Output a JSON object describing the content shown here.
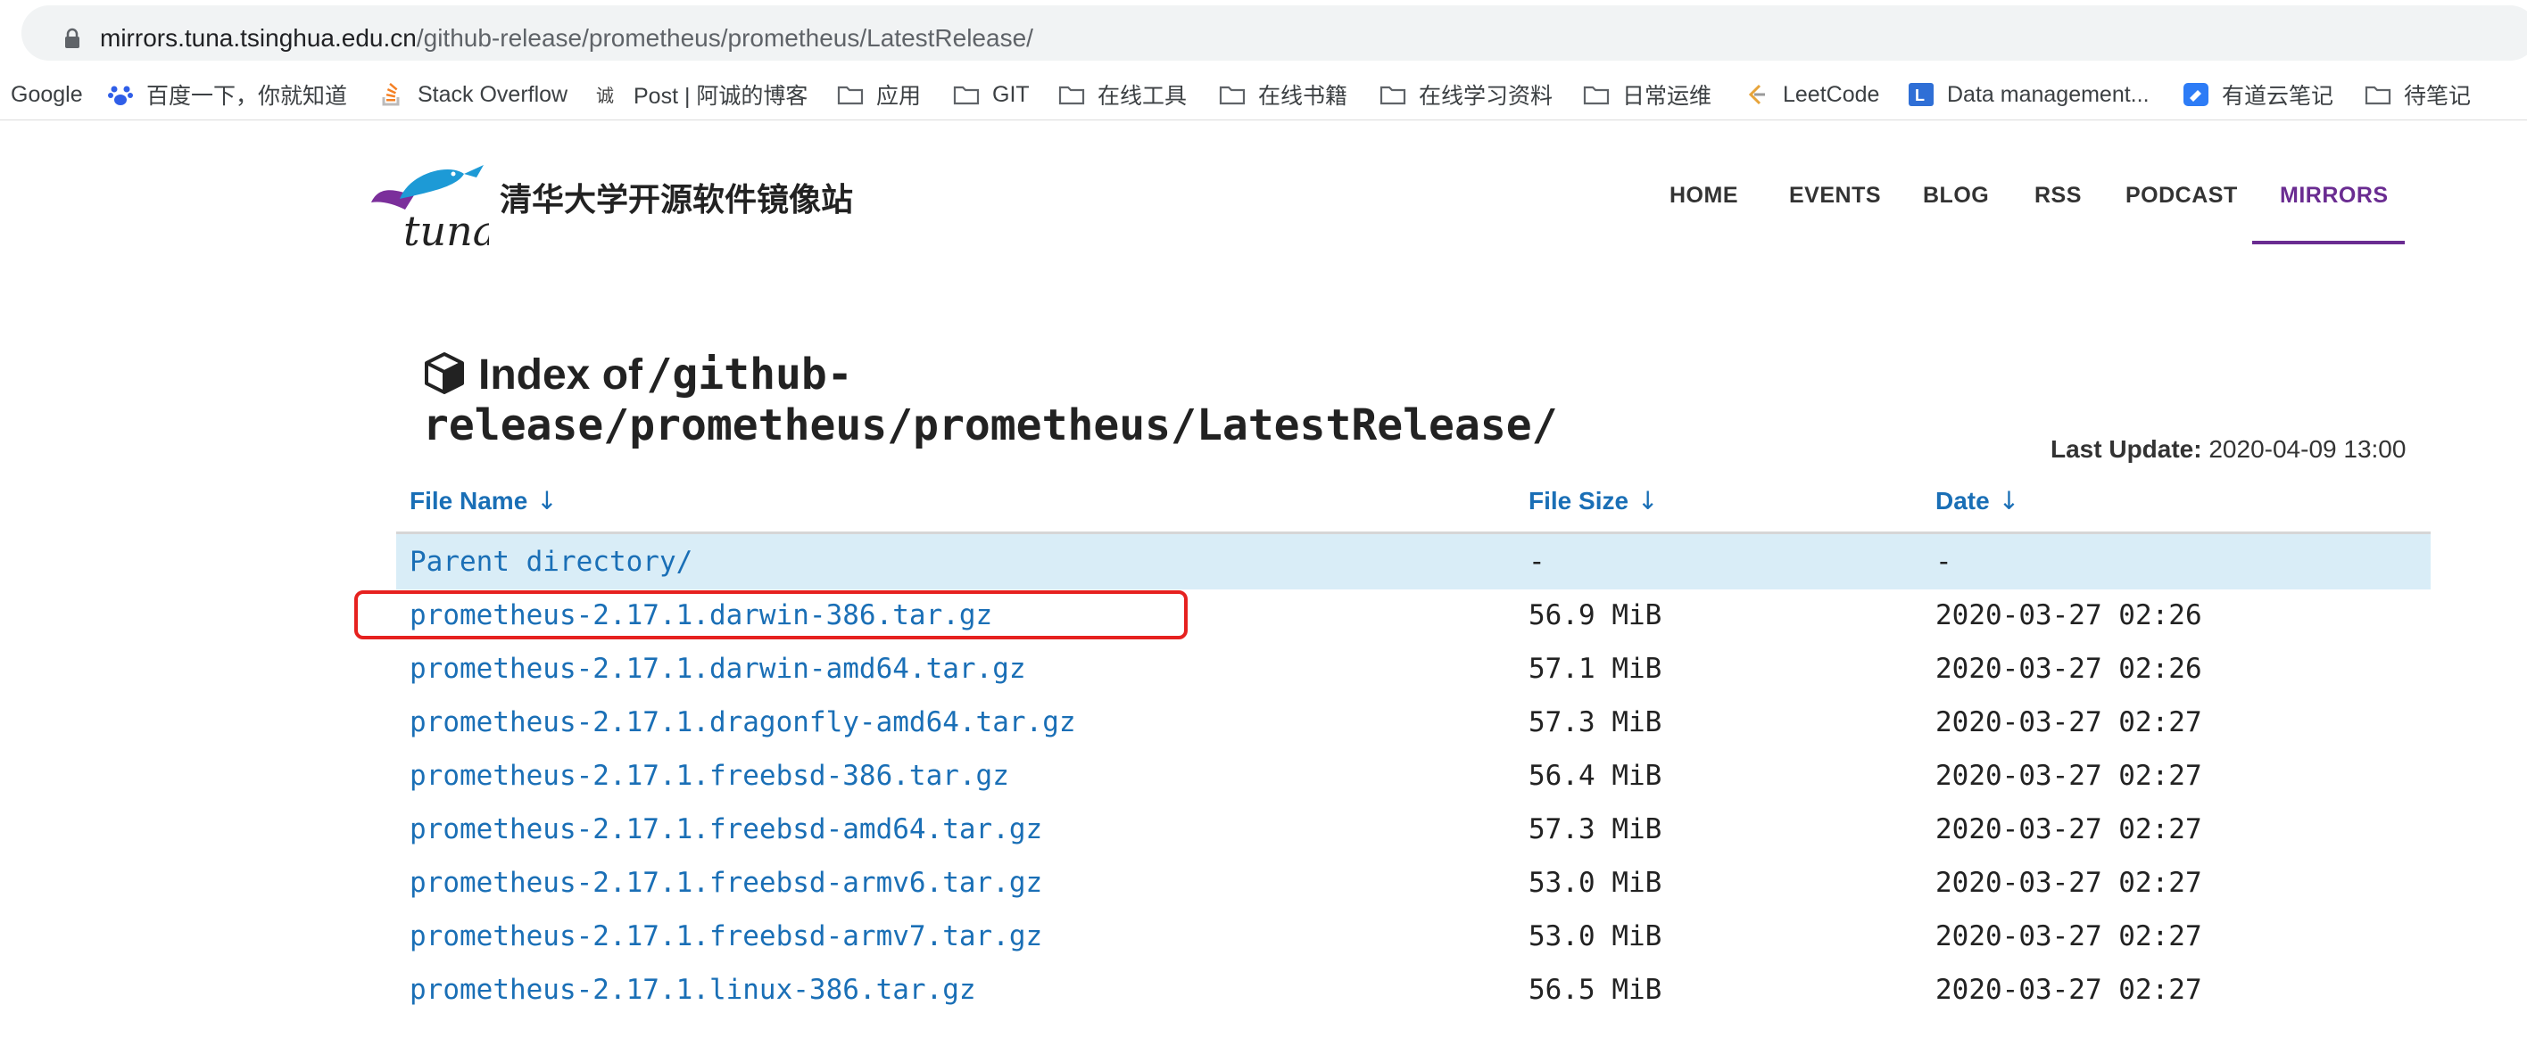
{
  "browser": {
    "url_host": "mirrors.tuna.tsinghua.edu.cn",
    "url_path": "/github-release/prometheus/prometheus/LatestRelease/"
  },
  "bookmarks": [
    {
      "label": "Google",
      "icon": "none"
    },
    {
      "label": "百度一下，你就知道",
      "icon": "baidu-paw-icon"
    },
    {
      "label": "Stack Overflow",
      "icon": "stackoverflow-icon"
    },
    {
      "label": "Post | 阿诚的博客",
      "icon": "blog-icon"
    },
    {
      "label": "应用",
      "icon": "folder-icon"
    },
    {
      "label": "GIT",
      "icon": "folder-icon"
    },
    {
      "label": "在线工具",
      "icon": "folder-icon"
    },
    {
      "label": "在线书籍",
      "icon": "folder-icon"
    },
    {
      "label": "在线学习资料",
      "icon": "folder-icon"
    },
    {
      "label": "日常运维",
      "icon": "folder-icon"
    },
    {
      "label": "LeetCode",
      "icon": "leetcode-icon"
    },
    {
      "label": "Data management...",
      "icon": "data-icon"
    },
    {
      "label": "有道云笔记",
      "icon": "youdao-icon"
    },
    {
      "label": "待笔记",
      "icon": "folder-icon"
    }
  ],
  "site": {
    "title": "清华大学开源软件镜像站",
    "logo_text": "tuna"
  },
  "nav": [
    {
      "label": "HOME"
    },
    {
      "label": "EVENTS"
    },
    {
      "label": "BLOG"
    },
    {
      "label": "RSS"
    },
    {
      "label": "PODCAST"
    },
    {
      "label": "MIRRORS",
      "active": true
    }
  ],
  "page": {
    "heading_prefix": "Index of",
    "heading_path_line1": "/github-",
    "heading_path_line2": "release/prometheus/prometheus/LatestRelease/",
    "last_update_label": "Last Update:",
    "last_update_value": "2020-04-09 13:00"
  },
  "table": {
    "columns": [
      {
        "label": "File Name",
        "sort": "↓"
      },
      {
        "label": "File Size",
        "sort": "↓"
      },
      {
        "label": "Date",
        "sort": "↓"
      }
    ],
    "parent": {
      "name": "Parent directory/",
      "size": "-",
      "date": "-"
    },
    "rows": [
      {
        "name": "prometheus-2.17.1.darwin-386.tar.gz",
        "size": "56.9 MiB",
        "date": "2020-03-27 02:26"
      },
      {
        "name": "prometheus-2.17.1.darwin-amd64.tar.gz",
        "size": "57.1 MiB",
        "date": "2020-03-27 02:26"
      },
      {
        "name": "prometheus-2.17.1.dragonfly-amd64.tar.gz",
        "size": "57.3 MiB",
        "date": "2020-03-27 02:27"
      },
      {
        "name": "prometheus-2.17.1.freebsd-386.tar.gz",
        "size": "56.4 MiB",
        "date": "2020-03-27 02:27"
      },
      {
        "name": "prometheus-2.17.1.freebsd-amd64.tar.gz",
        "size": "57.3 MiB",
        "date": "2020-03-27 02:27"
      },
      {
        "name": "prometheus-2.17.1.freebsd-armv6.tar.gz",
        "size": "53.0 MiB",
        "date": "2020-03-27 02:27"
      },
      {
        "name": "prometheus-2.17.1.freebsd-armv7.tar.gz",
        "size": "53.0 MiB",
        "date": "2020-03-27 02:27"
      },
      {
        "name": "prometheus-2.17.1.linux-386.tar.gz",
        "size": "56.5 MiB",
        "date": "2020-03-27 02:27"
      }
    ]
  },
  "colors": {
    "link": "#1a6fb6",
    "nav_active": "#6a2c91",
    "parent_row_bg": "#d9edf7",
    "highlight_box": "#e6211f"
  }
}
